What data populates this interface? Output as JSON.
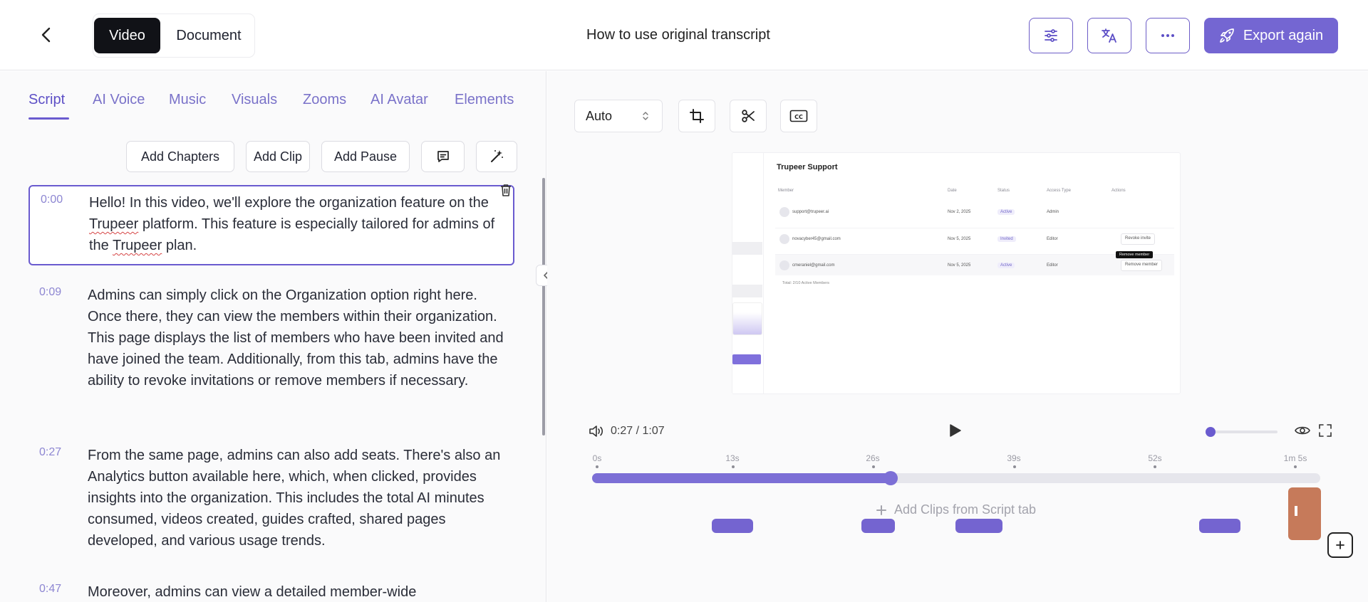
{
  "header": {
    "modes": [
      "Video",
      "Document"
    ],
    "title": "How to use original transcript",
    "export_label": "Export again"
  },
  "tabs": [
    "Script",
    "AI Voice",
    "Music",
    "Visuals",
    "Zooms",
    "AI Avatar",
    "Elements"
  ],
  "actions": {
    "add_chapters": "Add Chapters",
    "add_clip": "Add Clip",
    "add_pause": "Add Pause"
  },
  "segments": [
    {
      "time": "0:00",
      "parts": [
        "Hello! In this video, we'll explore the organization feature on the ",
        "Trupeer",
        " platform. This feature is especially tailored for admins of the ",
        "Trupeer",
        " plan."
      ]
    },
    {
      "time": "0:09",
      "text": "Admins can simply click on the Organization option right here. Once there, they can view the members within their organization. This page displays the list of members who have been invited and have joined the team. Additionally, from this tab, admins have the ability to revoke invitations or remove members if necessary."
    },
    {
      "time": "0:27",
      "text": "From the same page, admins can also add seats. There's also an Analytics button available here, which, when clicked, provides insights into the organization. This includes the total AI minutes consumed, videos created, guides crafted, shared pages developed, and various usage trends."
    },
    {
      "time": "0:47",
      "text": "Moreover, admins can view a detailed member-wide"
    }
  ],
  "editor": {
    "aspect": "Auto",
    "current_time": "0:27",
    "separator": "/",
    "duration": "1:07",
    "progress_fraction": 0.41,
    "zoom_fraction": 0.0,
    "ticks": [
      "0s",
      "13s",
      "26s",
      "39s",
      "52s",
      "1m 5s"
    ],
    "add_clips_label": "Add Clips from Script tab"
  },
  "preview": {
    "title": "Trupeer Support",
    "headers": [
      "Member",
      "Date",
      "Status",
      "Access Type",
      "Actions"
    ],
    "rows": [
      {
        "email": "support@trupeer.ai",
        "date": "Nov 2, 2025",
        "status": "Active",
        "access": "Admin",
        "action": ""
      },
      {
        "email": "novacyber45@gmail.com",
        "date": "Nov 5, 2025",
        "status": "Invited",
        "access": "Editor",
        "action": "Revoke invite"
      },
      {
        "email": "cmeraniel@gmail.com",
        "date": "Nov 5, 2025",
        "status": "Active",
        "access": "Editor",
        "action": "Remove member"
      }
    ],
    "tooltip": "Remove member",
    "footer": "Total: 2/10 Active Members"
  },
  "colors": {
    "accent": "#6a5bcf",
    "export": "#7466d2",
    "clip": "#c67a5a"
  }
}
